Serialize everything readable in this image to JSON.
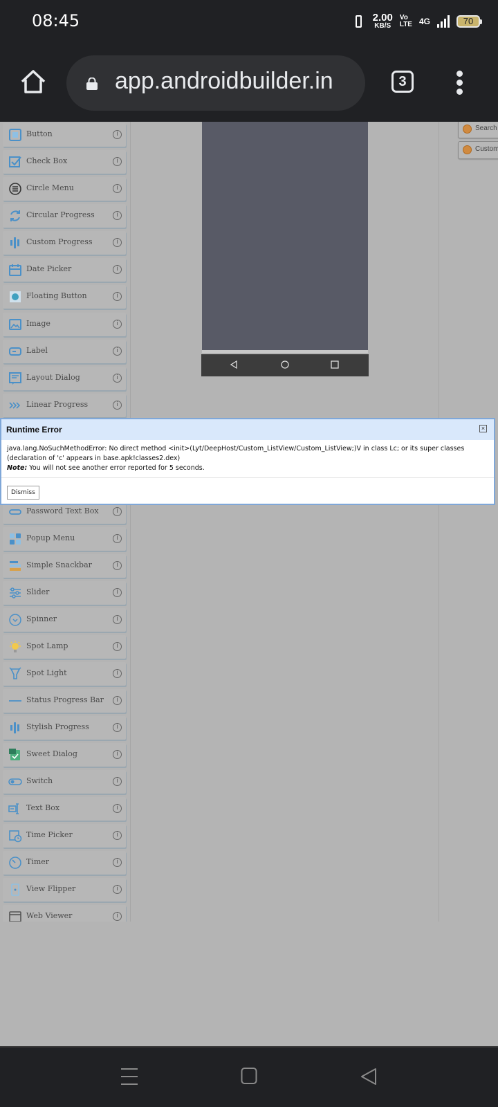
{
  "status_bar": {
    "time": "08:45",
    "data_rate_value": "2.00",
    "data_rate_unit": "KB/S",
    "volte_top": "Vo",
    "volte_bottom": "LTE",
    "network": "4G",
    "battery": "70"
  },
  "browser": {
    "url": "app.androidbuilder.in",
    "tab_count": "3"
  },
  "palette": {
    "items": [
      {
        "label": "Button",
        "icon": "button-icon"
      },
      {
        "label": "Check Box",
        "icon": "checkbox-icon"
      },
      {
        "label": "Circle Menu",
        "icon": "circle-menu-icon"
      },
      {
        "label": "Circular Progress",
        "icon": "circular-progress-icon"
      },
      {
        "label": "Custom Progress",
        "icon": "custom-progress-icon"
      },
      {
        "label": "Date Picker",
        "icon": "calendar-icon"
      },
      {
        "label": "Floating Button",
        "icon": "floating-button-icon"
      },
      {
        "label": "Image",
        "icon": "image-icon"
      },
      {
        "label": "Label",
        "icon": "label-icon"
      },
      {
        "label": "Layout Dialog",
        "icon": "layout-dialog-icon"
      },
      {
        "label": "Linear Progress",
        "icon": "linear-progress-icon"
      },
      {
        "label": "Password Text Box",
        "icon": "password-icon"
      },
      {
        "label": "Popup Menu",
        "icon": "popup-menu-icon"
      },
      {
        "label": "Simple Snackbar",
        "icon": "snackbar-icon"
      },
      {
        "label": "Slider",
        "icon": "slider-icon"
      },
      {
        "label": "Spinner",
        "icon": "spinner-icon"
      },
      {
        "label": "Spot Lamp",
        "icon": "lamp-icon"
      },
      {
        "label": "Spot Light",
        "icon": "spotlight-icon"
      },
      {
        "label": "Status Progress Bar",
        "icon": "status-progress-icon"
      },
      {
        "label": "Stylish Progress",
        "icon": "stylish-progress-icon"
      },
      {
        "label": "Sweet Dialog",
        "icon": "sweet-dialog-icon"
      },
      {
        "label": "Switch",
        "icon": "switch-icon"
      },
      {
        "label": "Text Box",
        "icon": "textbox-icon"
      },
      {
        "label": "Time Picker",
        "icon": "time-picker-icon"
      },
      {
        "label": "Timer",
        "icon": "timer-icon"
      },
      {
        "label": "View Flipper",
        "icon": "view-flipper-icon"
      },
      {
        "label": "Web Viewer",
        "icon": "web-viewer-icon"
      }
    ],
    "info_glyph": "i"
  },
  "right_panel": {
    "items": [
      {
        "label": "Search"
      },
      {
        "label": "Custom"
      }
    ]
  },
  "error_dialog": {
    "title": "Runtime Error",
    "message": "java.lang.NoSuchMethodError: No direct method <init>(Lyt/DeepHost/Custom_ListView/Custom_ListView;)V in class Lc; or its super classes (declaration of 'c' appears in base.apk!classes2.dex)",
    "note_label": "Note:",
    "note_text": "You will not see another error reported for 5 seconds.",
    "dismiss_label": "Dismiss",
    "close_glyph": "×"
  },
  "colors": {
    "chrome_dark": "#202124",
    "page_bg": "#b4b4b4",
    "dialog_header": "#d9e8fb",
    "dialog_border": "#7fa7d8",
    "icon_blue": "#4a90c8"
  }
}
